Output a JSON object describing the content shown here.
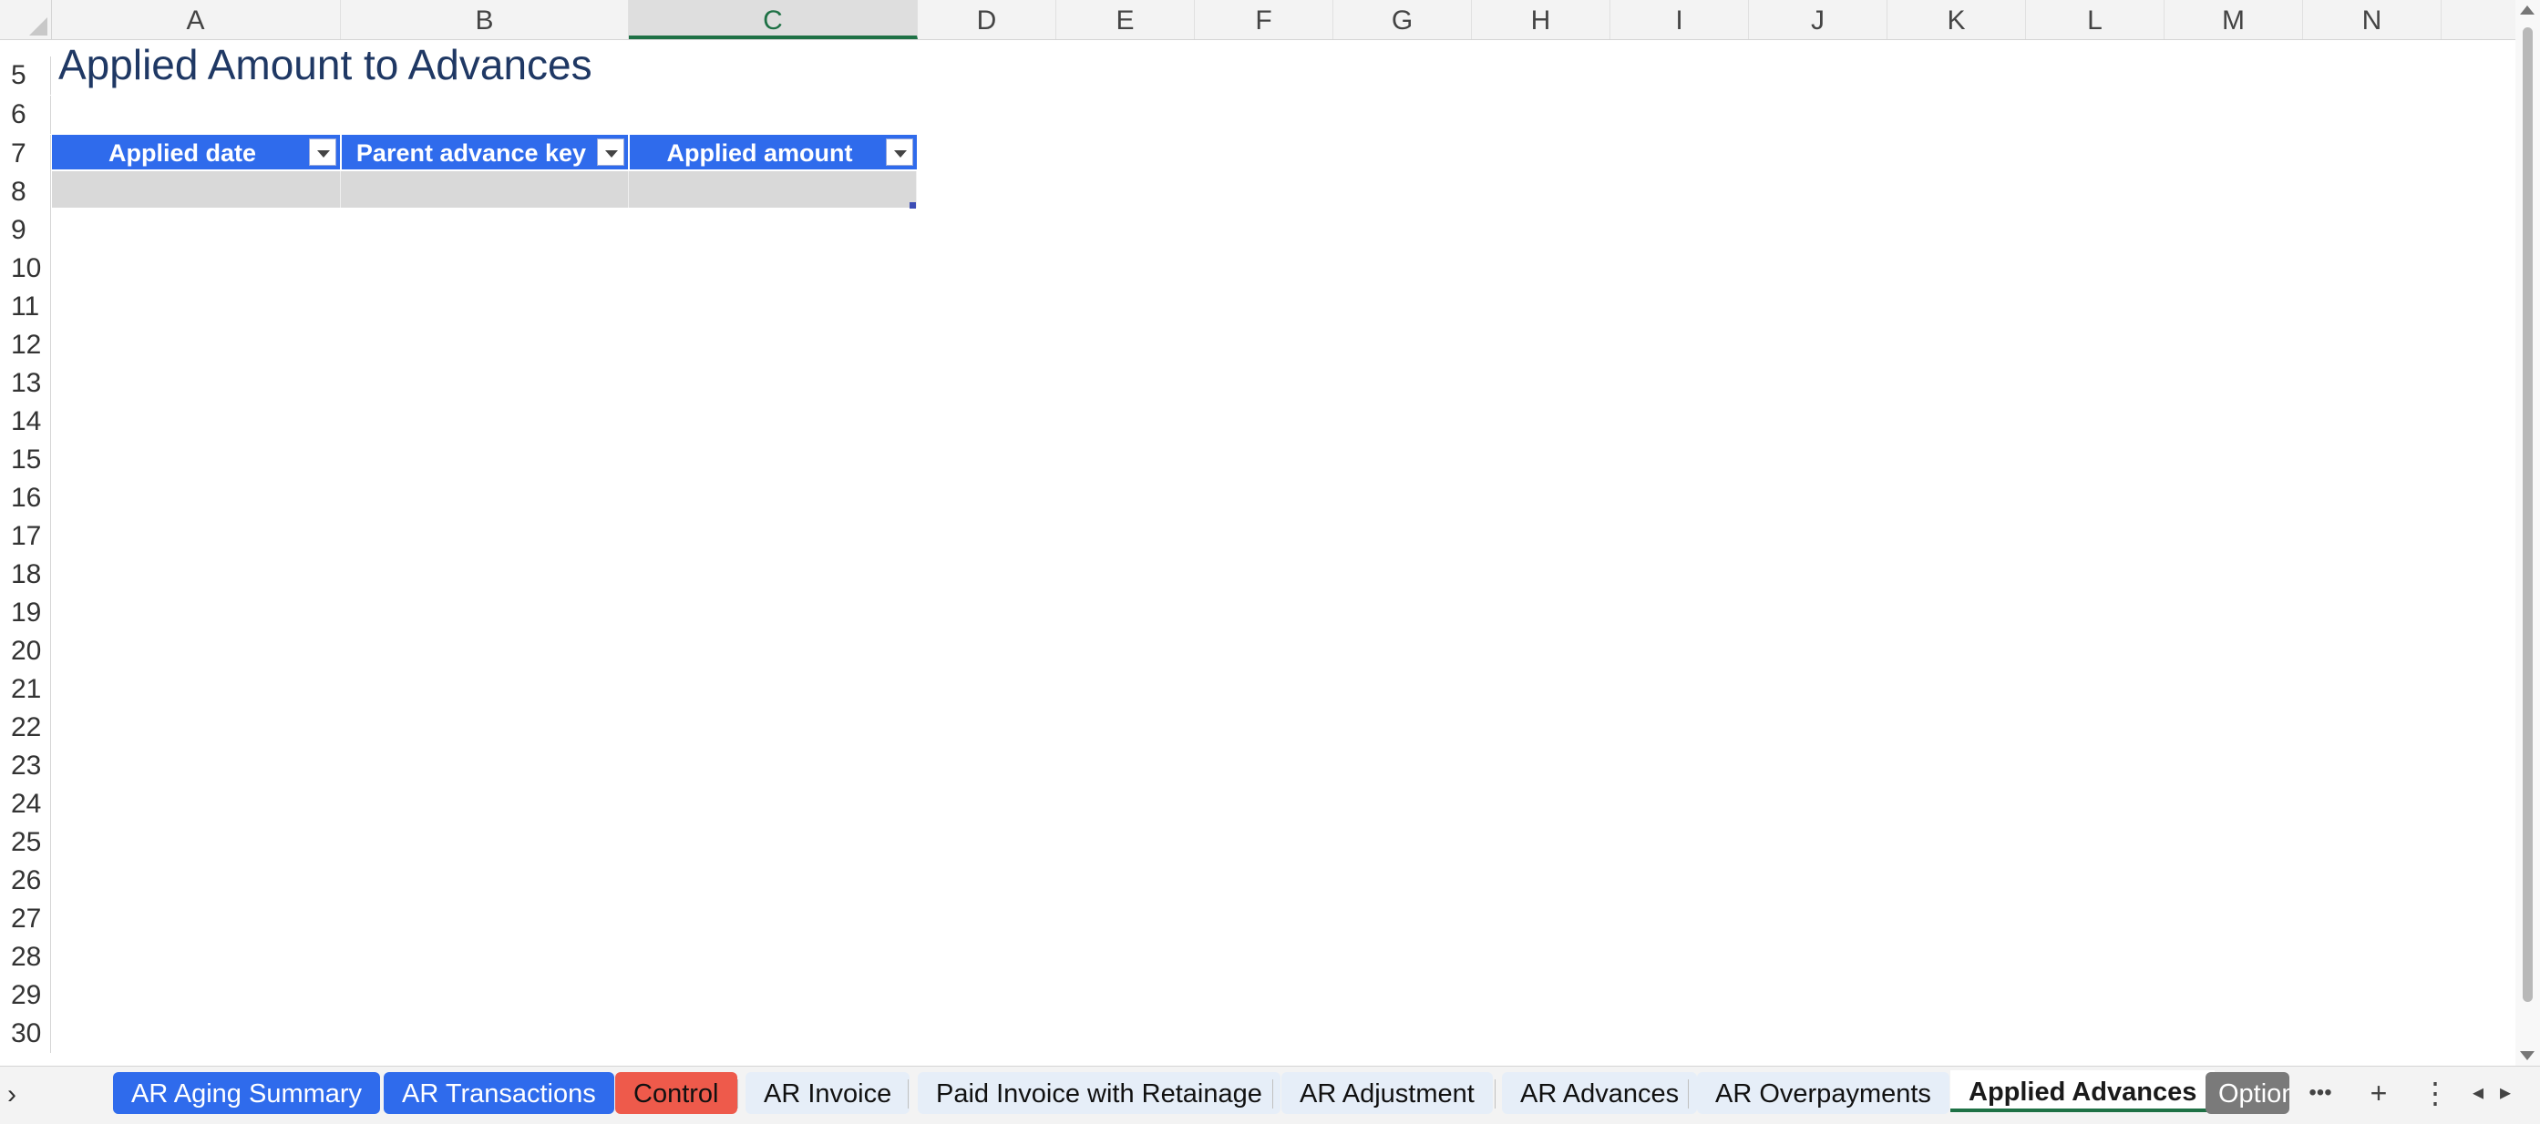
{
  "spreadsheet": {
    "columns": [
      "A",
      "B",
      "C",
      "D",
      "E",
      "F",
      "G",
      "H",
      "I",
      "J",
      "K",
      "L",
      "M",
      "N"
    ],
    "selected_column": "C",
    "rows": [
      "5",
      "6",
      "7",
      "8",
      "9",
      "10",
      "11",
      "12",
      "13",
      "14",
      "15",
      "16",
      "17",
      "18",
      "19",
      "20",
      "21",
      "22",
      "23",
      "24",
      "25",
      "26",
      "27",
      "28",
      "29",
      "30"
    ]
  },
  "content": {
    "title": "Applied Amount to Advances",
    "table_headers": [
      "Applied date",
      "Parent advance key",
      "Applied amount"
    ]
  },
  "tabs": [
    {
      "label": "AR Aging Summary",
      "style": "blue"
    },
    {
      "label": "AR Transactions",
      "style": "blue"
    },
    {
      "label": "Control",
      "style": "red"
    },
    {
      "label": "AR Invoice",
      "style": "light"
    },
    {
      "label": "Paid Invoice with Retainage",
      "style": "light"
    },
    {
      "label": "AR Adjustment",
      "style": "light"
    },
    {
      "label": "AR Advances",
      "style": "light"
    },
    {
      "label": "AR Overpayments",
      "style": "light"
    },
    {
      "label": "Applied Advances",
      "style": "active"
    },
    {
      "label": "Option",
      "style": "gray"
    }
  ],
  "tabbar_icons": {
    "expand": "›",
    "more": "•••",
    "add": "+",
    "menu": "⋮",
    "scroll_left": "◂",
    "scroll_right": "▸"
  },
  "colors": {
    "table_header": "#2f6bec",
    "title": "#1f3864",
    "active_tab_underline": "#1e7145",
    "control_tab": "#ee5a4b"
  }
}
